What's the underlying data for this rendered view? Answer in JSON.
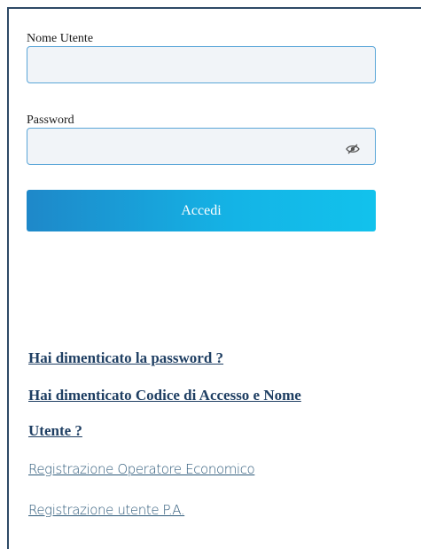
{
  "form": {
    "username_label": "Nome Utente",
    "username_value": "",
    "password_label": "Password",
    "password_value": "",
    "submit_label": "Accedi"
  },
  "links": {
    "forgot_password": "Hai dimenticato la password ?",
    "forgot_code_line1": "Hai dimenticato Codice di Accesso e Nome",
    "forgot_code_line2": "Utente ?",
    "register_operator": "Registrazione Operatore Economico",
    "register_pa": "Registrazione utente P.A."
  },
  "icons": {
    "password_toggle": "eye-slash-icon"
  },
  "colors": {
    "button_start": "#1e88c9",
    "button_end": "#12c2ec",
    "input_border": "#5aa6d8",
    "input_bg": "#f1f4f8",
    "link_dark": "#1f3f63",
    "link_light": "#2e5a7a"
  }
}
